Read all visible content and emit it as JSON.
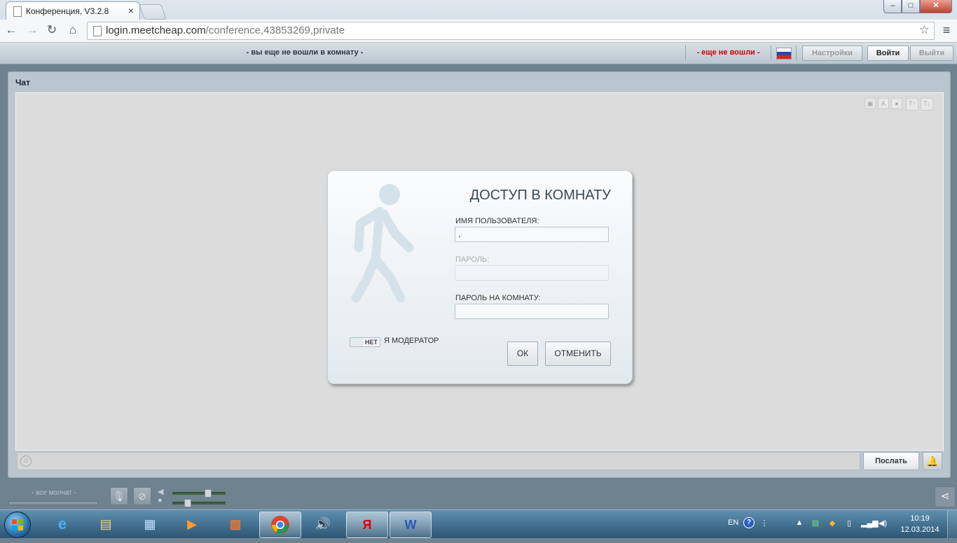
{
  "browser": {
    "tab_title": "Конференция, V3.2.8",
    "tab_close": "×",
    "url_host": "login.meetcheap.com",
    "url_path": "/conference,43853269,private",
    "window_controls": {
      "minimize": "–",
      "maximize": "□",
      "close": "✕"
    }
  },
  "header": {
    "room_status": "- вы еще не вошли в комнату -",
    "login_status": "- еще не вошли -",
    "settings_label": "Настройки",
    "login_label": "Войти",
    "logout_label": "Выйти",
    "flag": "russian-flag"
  },
  "chat": {
    "title": "Чат",
    "tools": [
      "image-icon",
      "font-icon",
      "color-icon",
      "font-increase-icon",
      "font-decrease-icon"
    ],
    "send_label": "Послать",
    "input_value": ""
  },
  "dialog": {
    "title": "ДОСТУП В КОМНАТУ",
    "username_label": "ИМЯ ПОЛЬЗОВАТЕЛЯ:",
    "username_value": ".",
    "password_label": "ПАРОЛЬ:",
    "password_value": "",
    "room_password_label": "ПАРОЛЬ НА КОМНАТУ:",
    "room_password_value": "",
    "moderator_toggle": "НЕТ",
    "moderator_label": "Я МОДЕРАТОР",
    "ok_label": "ОК",
    "cancel_label": "ОТМЕНИТЬ"
  },
  "media": {
    "silent_text": "- все молчат -",
    "mic_level": 0.7,
    "speaker_level": 0.25
  },
  "taskbar": {
    "lang": "EN",
    "time": "10:19",
    "date": "12.03.2014",
    "apps": [
      "internet-explorer",
      "file-explorer",
      "media-center",
      "media-player",
      "office-panel",
      "chrome",
      "volume-app",
      "yandex",
      "word"
    ]
  },
  "colors": {
    "login_status": "#cc0000",
    "app_background": "#6f8290",
    "chat_area": "#dcdcdc"
  }
}
